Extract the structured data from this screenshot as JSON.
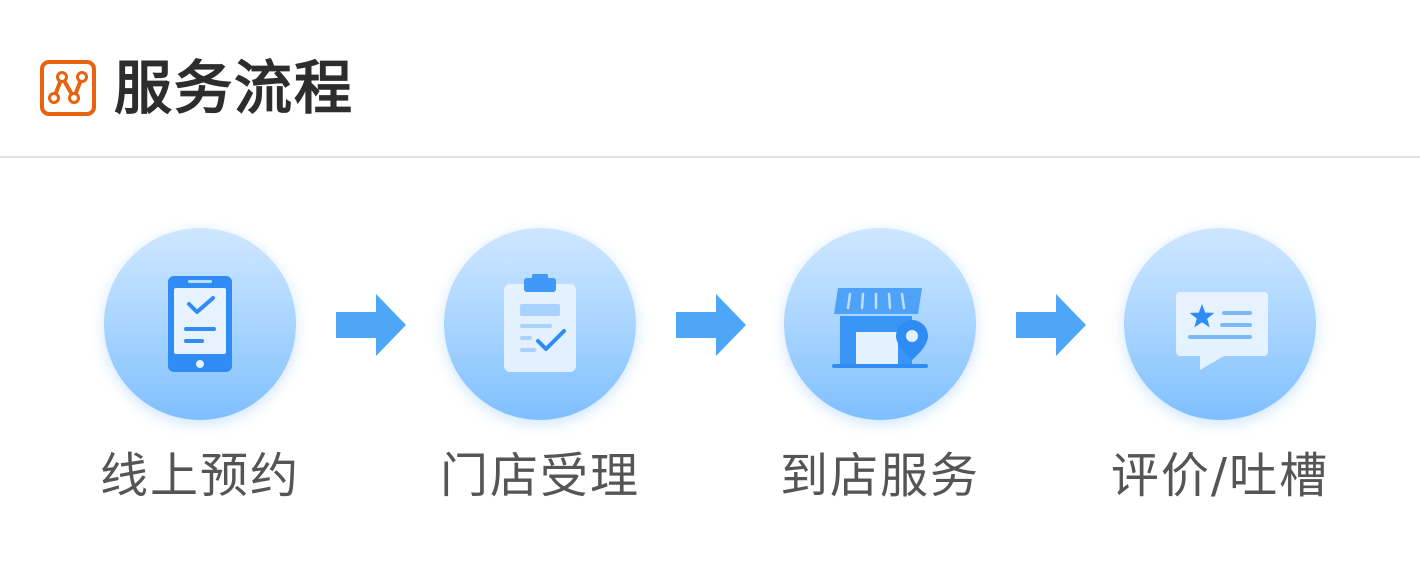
{
  "header": {
    "title": "服务流程",
    "icon": "route-icon",
    "accent_color": "#e8620f"
  },
  "steps": [
    {
      "label": "线上预约",
      "icon": "phone-check-icon"
    },
    {
      "label": "门店受理",
      "icon": "clipboard-check-icon"
    },
    {
      "label": "到店服务",
      "icon": "store-location-icon"
    },
    {
      "label": "评价/吐槽",
      "icon": "review-chat-icon"
    }
  ],
  "colors": {
    "circle_top": "#cfe7ff",
    "circle_bottom": "#7fbfff",
    "icon_blue": "#2f8cf5",
    "arrow_blue": "#4da6f8"
  }
}
